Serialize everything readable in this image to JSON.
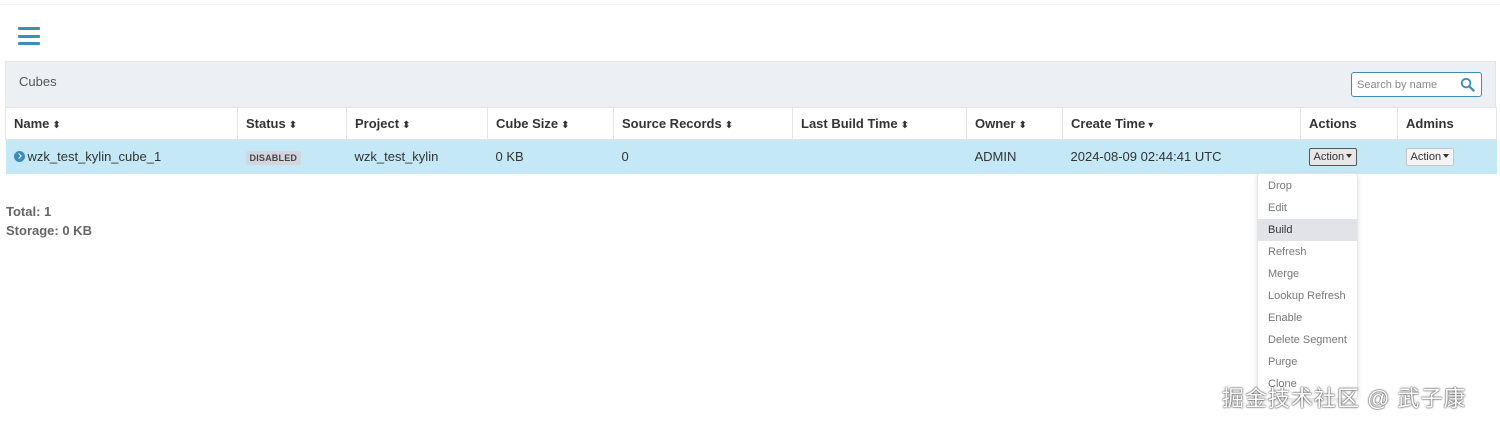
{
  "panel": {
    "title": "Cubes",
    "search_placeholder": "Search by name"
  },
  "table": {
    "columns": [
      {
        "label": "Name",
        "sort": "⬍"
      },
      {
        "label": "Status",
        "sort": "⬍"
      },
      {
        "label": "Project",
        "sort": "⬍"
      },
      {
        "label": "Cube Size",
        "sort": "⬍"
      },
      {
        "label": "Source Records",
        "sort": "⬍"
      },
      {
        "label": "Last Build Time",
        "sort": "⬍"
      },
      {
        "label": "Owner",
        "sort": "⬍"
      },
      {
        "label": "Create Time",
        "sort": "▾"
      },
      {
        "label": "Actions",
        "sort": ""
      },
      {
        "label": "Admins",
        "sort": ""
      }
    ],
    "rows": [
      {
        "name": "wzk_test_kylin_cube_1",
        "status": "DISABLED",
        "project": "wzk_test_kylin",
        "cube_size": "0 KB",
        "source_records": "0",
        "last_build_time": "",
        "owner": "ADMIN",
        "create_time": "2024-08-09 02:44:41 UTC",
        "action_label": "Action",
        "admin_label": "Action"
      }
    ]
  },
  "totals": {
    "total": "Total: 1",
    "storage": "Storage: 0 KB"
  },
  "action_menu": {
    "items": [
      "Drop",
      "Edit",
      "Build",
      "Refresh",
      "Merge",
      "Lookup Refresh",
      "Enable",
      "Delete Segment",
      "Purge",
      "Clone"
    ],
    "highlighted": "Build"
  },
  "watermark": "掘金技术社区 @ 武子康",
  "colors": {
    "accent": "#3c8dbc",
    "row_highlight": "#c5e8f7",
    "header_bg": "#ecf0f5"
  },
  "icons": {
    "menu": "hamburger-menu-icon",
    "search": "search-icon",
    "expand": "expand-circle-icon",
    "caret": "caret-down-icon"
  }
}
